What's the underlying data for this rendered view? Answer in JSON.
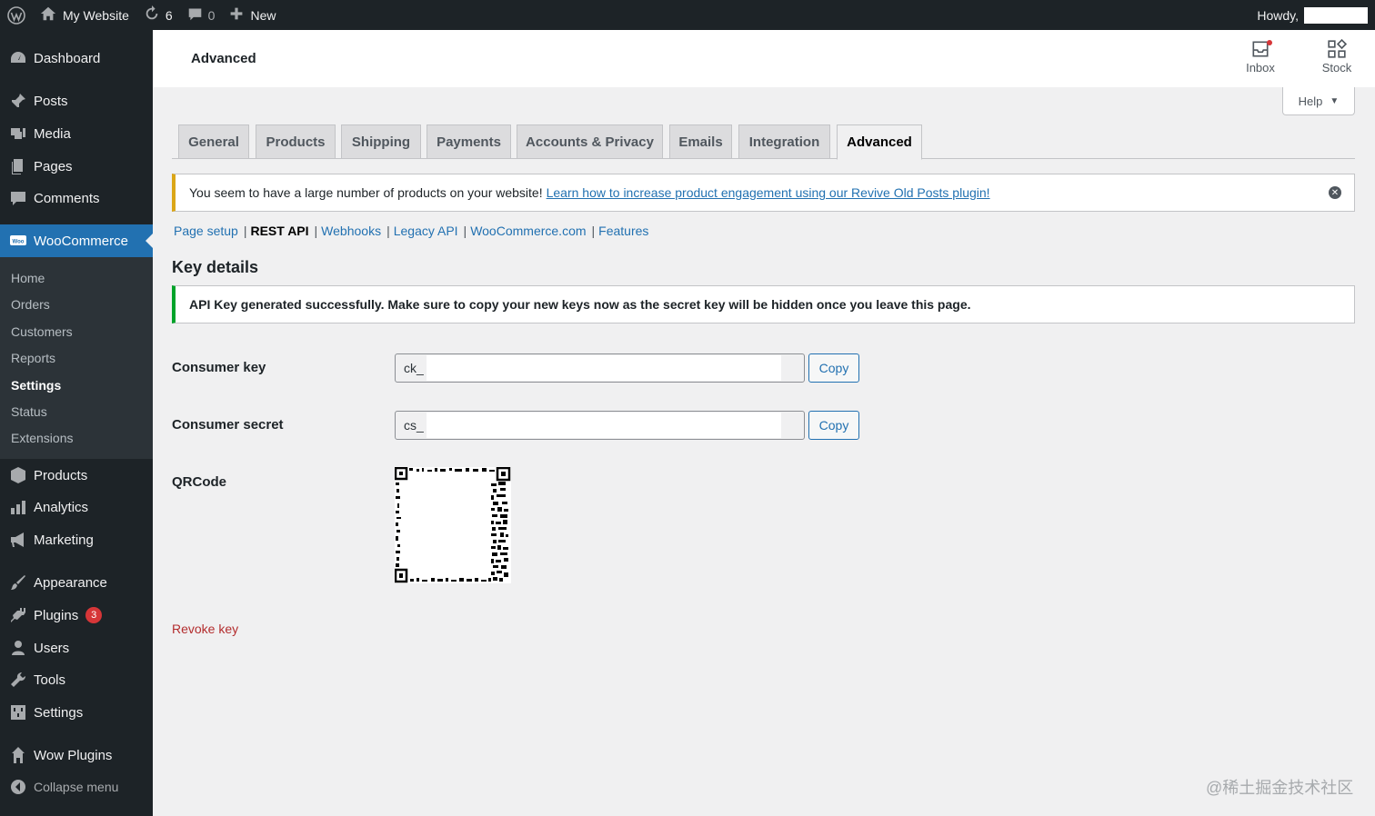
{
  "adminbar": {
    "site_name": "My Website",
    "updates_count": "6",
    "comments_count": "0",
    "new_label": "New",
    "howdy": "Howdy,"
  },
  "sidebar": {
    "items": [
      {
        "label": "Dashboard",
        "icon": "dashboard-icon"
      },
      {
        "label": "Posts",
        "icon": "pin-icon"
      },
      {
        "label": "Media",
        "icon": "media-icon"
      },
      {
        "label": "Pages",
        "icon": "pages-icon"
      },
      {
        "label": "Comments",
        "icon": "comment-icon"
      },
      {
        "label": "WooCommerce",
        "icon": "woo-icon"
      },
      {
        "label": "Products",
        "icon": "products-icon"
      },
      {
        "label": "Analytics",
        "icon": "analytics-icon"
      },
      {
        "label": "Marketing",
        "icon": "megaphone-icon"
      },
      {
        "label": "Appearance",
        "icon": "brush-icon"
      },
      {
        "label": "Plugins",
        "icon": "plugin-icon",
        "badge": "3"
      },
      {
        "label": "Users",
        "icon": "users-icon"
      },
      {
        "label": "Tools",
        "icon": "wrench-icon"
      },
      {
        "label": "Settings",
        "icon": "settings-icon"
      },
      {
        "label": "Wow Plugins",
        "icon": "wow-icon"
      }
    ],
    "woo_submenu": [
      "Home",
      "Orders",
      "Customers",
      "Reports",
      "Settings",
      "Status",
      "Extensions"
    ],
    "collapse_label": "Collapse menu"
  },
  "header": {
    "title": "Advanced",
    "inbox_label": "Inbox",
    "stock_label": "Stock",
    "help_label": "Help"
  },
  "tabs": [
    "General",
    "Products",
    "Shipping",
    "Payments",
    "Accounts & Privacy",
    "Emails",
    "Integration",
    "Advanced"
  ],
  "notice": {
    "text": "You seem to have a large number of products on your website!",
    "link": "Learn how to increase product engagement using our Revive Old Posts plugin!"
  },
  "subsub": [
    "Page setup",
    "REST API",
    "Webhooks",
    "Legacy API",
    "WooCommerce.com",
    "Features"
  ],
  "section_title": "Key details",
  "success_message": "API Key generated successfully. Make sure to copy your new keys now as the secret key will be hidden once you leave this page.",
  "fields": {
    "consumer_key_label": "Consumer key",
    "consumer_key_value": "ck_",
    "consumer_secret_label": "Consumer secret",
    "consumer_secret_value": "cs_",
    "copy_label": "Copy",
    "qrcode_label": "QRCode"
  },
  "revoke_label": "Revoke key",
  "watermark": "@稀土掘金技术社区",
  "colors": {
    "admin_bg": "#1d2327",
    "accent": "#2271b1",
    "warning": "#dba617",
    "success": "#00a32a",
    "danger": "#b32d2e"
  }
}
